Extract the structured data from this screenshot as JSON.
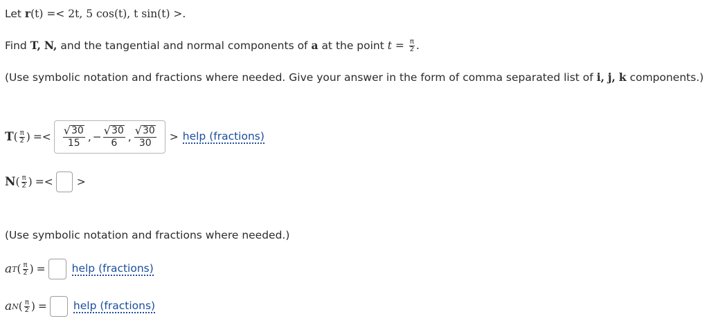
{
  "problem": {
    "let_prefix": "Let",
    "r_symbol": "r",
    "r_arg": "(t)",
    "r_eq": " =< 2t, 5 cos(t), t sin(t) >.",
    "find_prefix": "Find",
    "find_T": "T,",
    "find_N": "N,",
    "find_mid": "and the tangential and normal components of",
    "find_a": "a",
    "find_suffix": "at the point",
    "point_lhs": "t =",
    "point_num": "π",
    "point_den": "2",
    "point_end": ".",
    "instructions": "(Use symbolic notation and fractions where needed. Give your answer in the form of comma separated list of",
    "instr_i": "i,",
    "instr_j": "j,",
    "instr_k": "k",
    "instr_end": "components.)"
  },
  "T_row": {
    "label": "T",
    "arg_num": "π",
    "arg_den": "2",
    "eq": "=<",
    "components": [
      {
        "sign": "",
        "radicand": "30",
        "den": "15"
      },
      {
        "sign": "−",
        "radicand": "30",
        "den": "6"
      },
      {
        "sign": "",
        "radicand": "30",
        "den": "30"
      }
    ],
    "close": ">",
    "help": "help (fractions)"
  },
  "N_row": {
    "label": "N",
    "arg_num": "π",
    "arg_den": "2",
    "eq": "=<",
    "close": ">",
    "value": ""
  },
  "second_instructions": "(Use symbolic notation and fractions where needed.)",
  "aT_row": {
    "label": "a",
    "sub": "T",
    "arg_num": "π",
    "arg_den": "2",
    "eq": "=",
    "value": "",
    "help": "help (fractions)"
  },
  "aN_row": {
    "label": "a",
    "sub": "N",
    "arg_num": "π",
    "arg_den": "2",
    "eq": "=",
    "value": "",
    "help": "help (fractions)"
  }
}
